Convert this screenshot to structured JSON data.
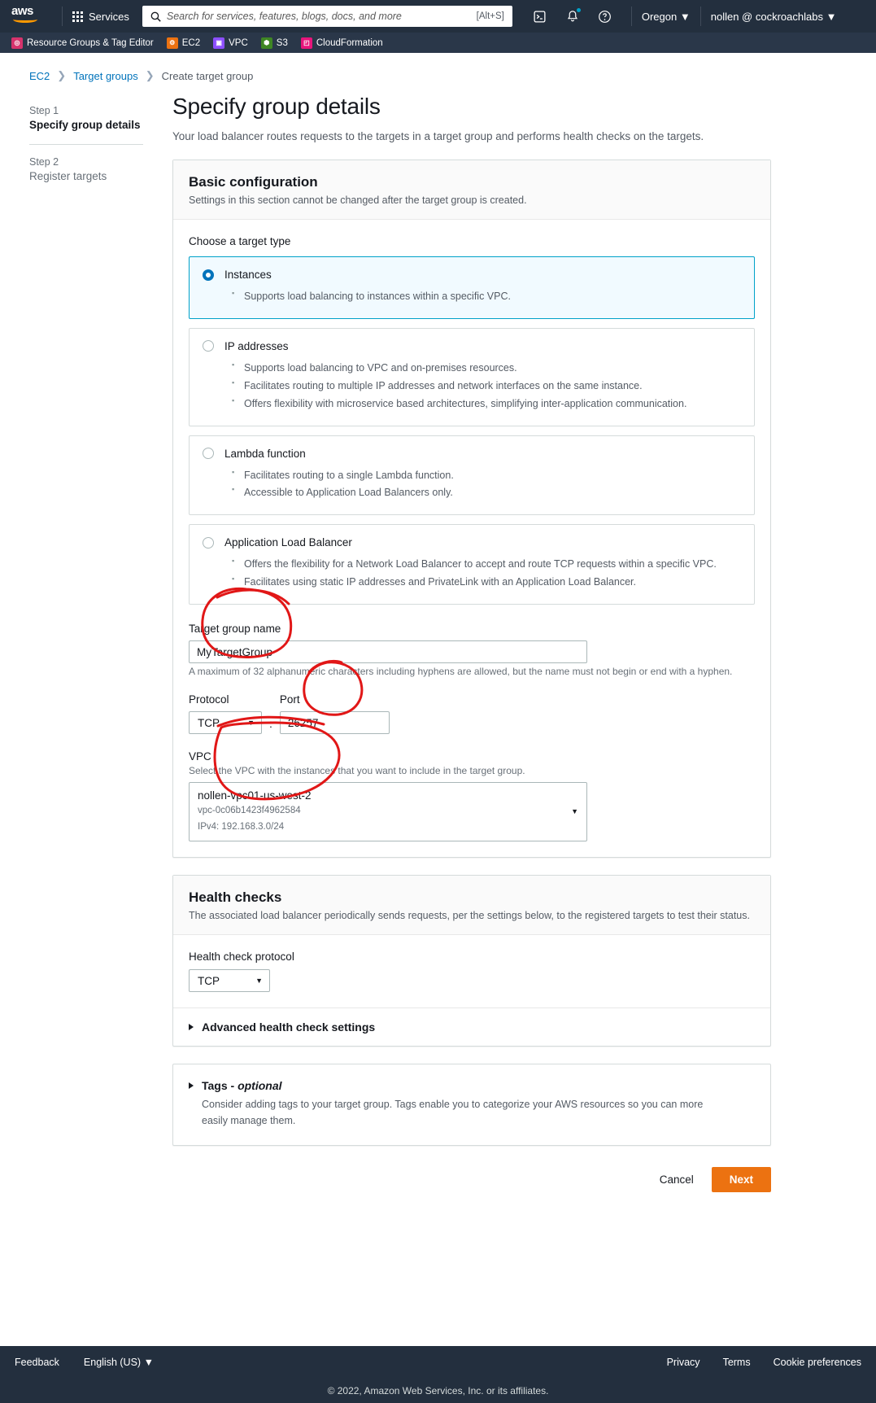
{
  "topnav": {
    "logo_text": "aws",
    "services_label": "Services",
    "search_placeholder": "Search for services, features, blogs, docs, and more",
    "search_value": "",
    "search_shortcut": "[Alt+S]",
    "cloudshell_icon": "cloudshell-icon",
    "notifications_icon": "bell-icon",
    "help_icon": "question-circle-icon",
    "region_label": "Oregon",
    "account_label": "nollen @ cockroachlabs"
  },
  "favorites": [
    {
      "label": "Resource Groups & Tag Editor",
      "color": "#d6336c",
      "glyph": "◎"
    },
    {
      "label": "EC2",
      "color": "#ec7211",
      "glyph": "⚙"
    },
    {
      "label": "VPC",
      "color": "#8c4fff",
      "glyph": "▣"
    },
    {
      "label": "S3",
      "color": "#3f8624",
      "glyph": "⬢"
    },
    {
      "label": "CloudFormation",
      "color": "#e7157b",
      "glyph": "◰"
    }
  ],
  "breadcrumb": {
    "items": [
      "EC2",
      "Target groups"
    ],
    "current": "Create target group",
    "separator": "❯"
  },
  "wizard": {
    "step1_label": "Step 1",
    "step1_name": "Specify group details",
    "step2_label": "Step 2",
    "step2_name": "Register targets"
  },
  "page": {
    "title": "Specify group details",
    "description": "Your load balancer routes requests to the targets in a target group and performs health checks on the targets."
  },
  "basic_configuration": {
    "heading": "Basic configuration",
    "subheading": "Settings in this section cannot be changed after the target group is created.",
    "target_type_label": "Choose a target type",
    "target_types": [
      {
        "title": "Instances",
        "selected": true,
        "bullets": [
          "Supports load balancing to instances within a specific VPC."
        ]
      },
      {
        "title": "IP addresses",
        "selected": false,
        "bullets": [
          "Supports load balancing to VPC and on-premises resources.",
          "Facilitates routing to multiple IP addresses and network interfaces on the same instance.",
          "Offers flexibility with microservice based architectures, simplifying inter-application communication."
        ]
      },
      {
        "title": "Lambda function",
        "selected": false,
        "bullets": [
          "Facilitates routing to a single Lambda function.",
          "Accessible to Application Load Balancers only."
        ]
      },
      {
        "title": "Application Load Balancer",
        "selected": false,
        "bullets": [
          "Offers the flexibility for a Network Load Balancer to accept and route TCP requests within a specific VPC.",
          "Facilitates using static IP addresses and PrivateLink with an Application Load Balancer."
        ]
      }
    ],
    "name_label": "Target group name",
    "name_value": "MyTargetGroup",
    "name_hint": "A maximum of 32 alphanumeric characters including hyphens are allowed, but the name must not begin or end with a hyphen.",
    "protocol_label": "Protocol",
    "protocol_value": "TCP",
    "port_label": "Port",
    "port_value": "26257",
    "colon": ":",
    "vpc_label": "VPC",
    "vpc_hint": "Select the VPC with the instances that you want to include in the target group.",
    "vpc_name": "nollen-vpc01-us-west-2",
    "vpc_id": "vpc-0c06b1423f4962584",
    "vpc_cidr": "IPv4: 192.168.3.0/24"
  },
  "health_checks": {
    "heading": "Health checks",
    "subheading": "The associated load balancer periodically sends requests, per the settings below, to the registered targets to test their status.",
    "protocol_label": "Health check protocol",
    "protocol_value": "TCP",
    "advanced_label": "Advanced health check settings"
  },
  "tags": {
    "label": "Tags - ",
    "label_em": "optional",
    "description": "Consider adding tags to your target group. Tags enable you to categorize your AWS resources so you can more easily manage them."
  },
  "actions": {
    "cancel_label": "Cancel",
    "next_label": "Next",
    "next_color": "#ec7211"
  },
  "footer": {
    "feedback": "Feedback",
    "language": "English (US)",
    "privacy": "Privacy",
    "terms": "Terms",
    "cookie": "Cookie preferences",
    "copyright": "© 2022, Amazon Web Services, Inc. or its affiliates."
  },
  "annotations": {
    "color": "#e11717",
    "circles": [
      "target-group-name",
      "port",
      "vpc"
    ]
  }
}
